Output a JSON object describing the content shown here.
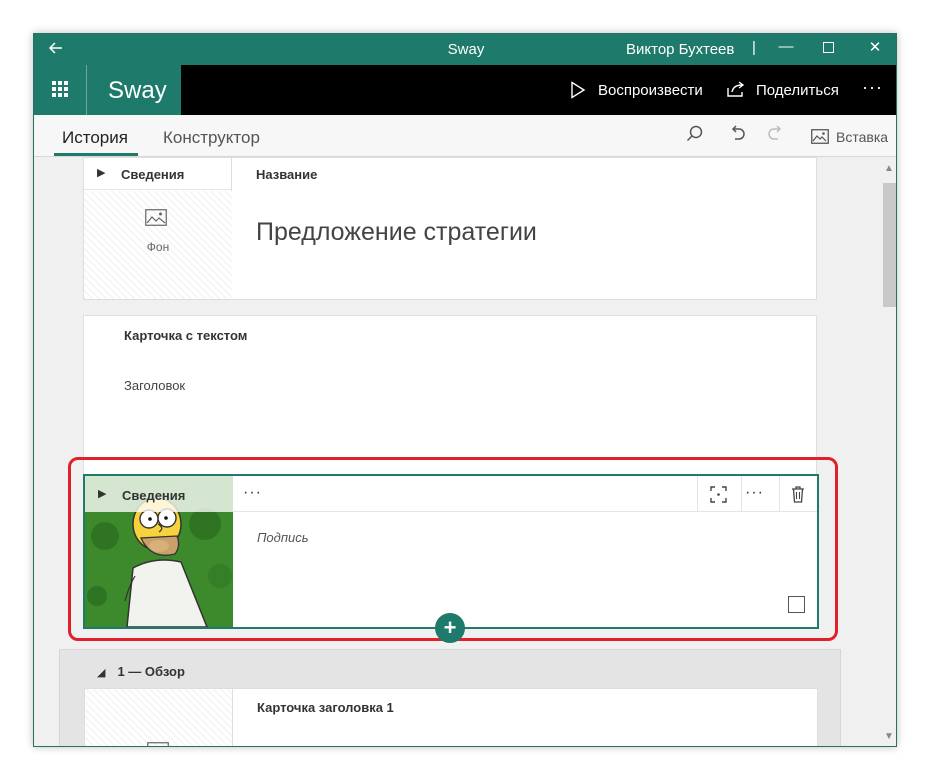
{
  "titlebar": {
    "back_icon": "arrow-left-icon",
    "app_title": "Sway",
    "user_name": "Виктор Бухтеев",
    "separator": "|",
    "minimize": "—",
    "maximize": "☐",
    "close": "✕"
  },
  "appbar": {
    "brand": "Sway",
    "play_label": "Воспроизвести",
    "share_label": "Поделиться",
    "more": "···"
  },
  "tabs": {
    "story": "История",
    "designer": "Конструктор",
    "insert_label": "Вставка"
  },
  "cards": {
    "title_card": {
      "side_header": "Сведения",
      "background_label": "Фон",
      "field_label": "Название",
      "title_text": "Предложение стратегии"
    },
    "text_card": {
      "field_label": "Карточка с текстом",
      "heading_text": "Заголовок"
    },
    "image_card": {
      "side_header": "Сведения",
      "toolbar_more": "···",
      "caption_placeholder": "Подпись"
    }
  },
  "section": {
    "header": "1 — Обзор",
    "title_card_label": "Карточка заголовка 1"
  },
  "colors": {
    "accent": "#1e7a6a",
    "highlight": "#e0202a",
    "appbar": "#000000"
  }
}
